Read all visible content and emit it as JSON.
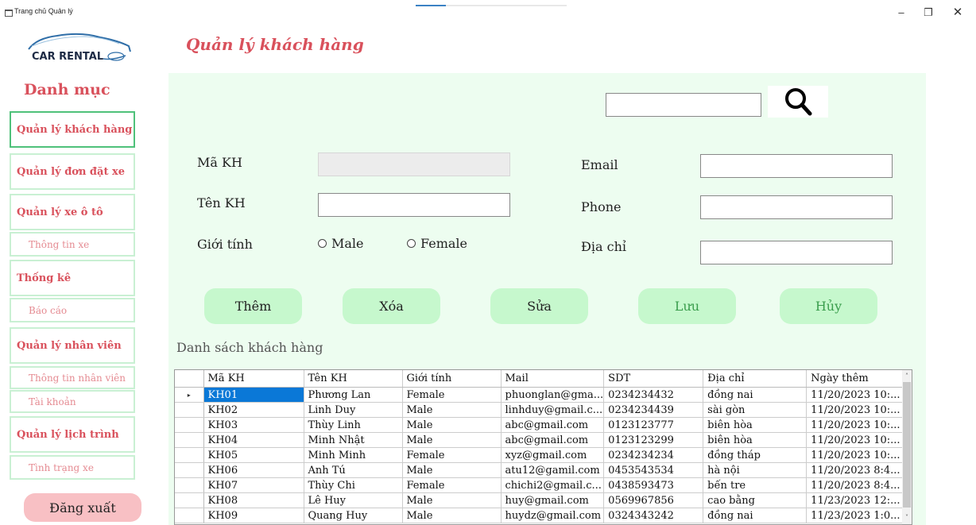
{
  "window": {
    "title": "Trang chủ Quản lý",
    "minimize": "–",
    "maximize": "❐",
    "close": "✕"
  },
  "logo": {
    "text": "CAR RENTAL",
    "icon": "car-logo-icon"
  },
  "sidebar": {
    "heading": "Danh mục",
    "items": [
      {
        "label": "Quản lý khách hàng"
      },
      {
        "label": "Quản lý đơn đặt xe"
      },
      {
        "label": "Quản lý xe ô tô"
      },
      {
        "label": "Thông tin xe"
      },
      {
        "label": "Thống kê"
      },
      {
        "label": "Báo cáo"
      },
      {
        "label": "Quản lý nhân viên"
      },
      {
        "label": "Thông tin nhân viên"
      },
      {
        "label": "Tài khoản"
      },
      {
        "label": "Quản lý lịch trình"
      },
      {
        "label": "Tình trạng xe"
      }
    ],
    "logout": "Đăng xuất"
  },
  "main": {
    "title": "Quản lý khách hàng",
    "search": {
      "value": "",
      "icon": "search-icon"
    },
    "form": {
      "id_label": "Mã KH",
      "name_label": "Tên KH",
      "gender_label": "Giới tính",
      "male": "Male",
      "female": "Female",
      "email_label": "Email",
      "phone_label": "Phone",
      "address_label": "Địa chỉ"
    },
    "buttons": {
      "add": "Thêm",
      "delete": "Xóa",
      "edit": "Sửa",
      "save": "Lưu",
      "cancel": "Hủy"
    },
    "list_label": "Danh sách khách hàng",
    "table": {
      "columns": [
        "Mã KH",
        "Tên KH",
        "Giới tính",
        "Mail",
        "SDT",
        "Địa chỉ",
        "Ngày thêm"
      ],
      "rows": [
        [
          "KH01",
          "Phương Lan",
          "Female",
          "phuonglan@gma...",
          "0234234432",
          "đồng nai",
          "11/20/2023 10:..."
        ],
        [
          "KH02",
          "Linh Duy",
          "Male",
          "linhduy@gmail.c...",
          "0234234439",
          "sài gòn",
          "11/20/2023 10:..."
        ],
        [
          "KH03",
          "Thùy Linh",
          "Male",
          "abc@gmail.com",
          "0123123777",
          "biên hòa",
          "11/20/2023 10:..."
        ],
        [
          "KH04",
          "Minh Nhật",
          "Male",
          "abc@gmail.com",
          "0123123299",
          "biên hòa",
          "11/20/2023 10:..."
        ],
        [
          "KH05",
          "Minh Minh",
          "Female",
          "xyz@gmail.com",
          "0234234234",
          "đồng tháp",
          "11/20/2023 10:..."
        ],
        [
          "KH06",
          "Anh Tú",
          "Male",
          "atu12@gamil.com",
          "0453543534",
          "hà nội",
          "11/20/2023 8:4..."
        ],
        [
          "KH07",
          "Thùy Chi",
          "Female",
          "chichi2@gmail.c...",
          "0438593473",
          "bến tre",
          "11/20/2023 8:4..."
        ],
        [
          "KH08",
          "Lê Huy",
          "Male",
          "huy@gmail.com",
          "0569967856",
          "cao bằng",
          "11/23/2023 12:..."
        ],
        [
          "KH09",
          "Quang Huy",
          "Male",
          "huydz@gmail.com",
          "0324343242",
          "đồng nai",
          "11/23/2023 1:0..."
        ]
      ]
    }
  },
  "colors": {
    "accent": "#d9515c",
    "panel": "#edfdf0",
    "button": "#c6f8cd",
    "selection": "#0a78d7",
    "logout": "#f8c0c4"
  }
}
